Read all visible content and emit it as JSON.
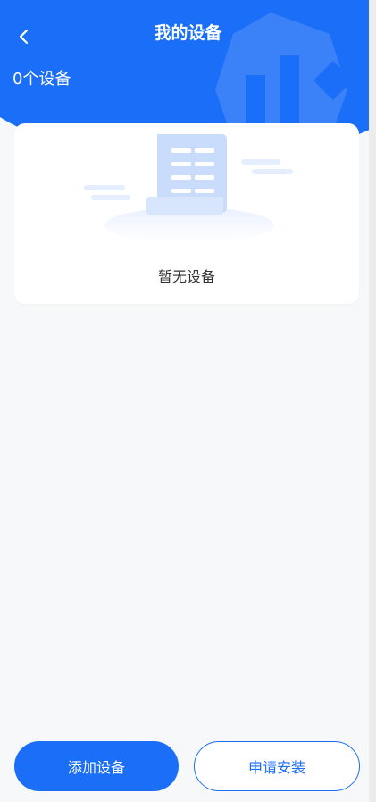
{
  "header": {
    "title": "我的设备",
    "back_icon": "chevron-left-icon",
    "device_count": "0个设备"
  },
  "empty_state": {
    "text": "暂无设备",
    "icon": "empty-document-illustration"
  },
  "actions": {
    "add_device_label": "添加设备",
    "apply_install_label": "申请安装"
  },
  "colors": {
    "accent": "#1a6ef7",
    "background": "#f7f8f9",
    "card": "#ffffff",
    "text": "#333333"
  }
}
